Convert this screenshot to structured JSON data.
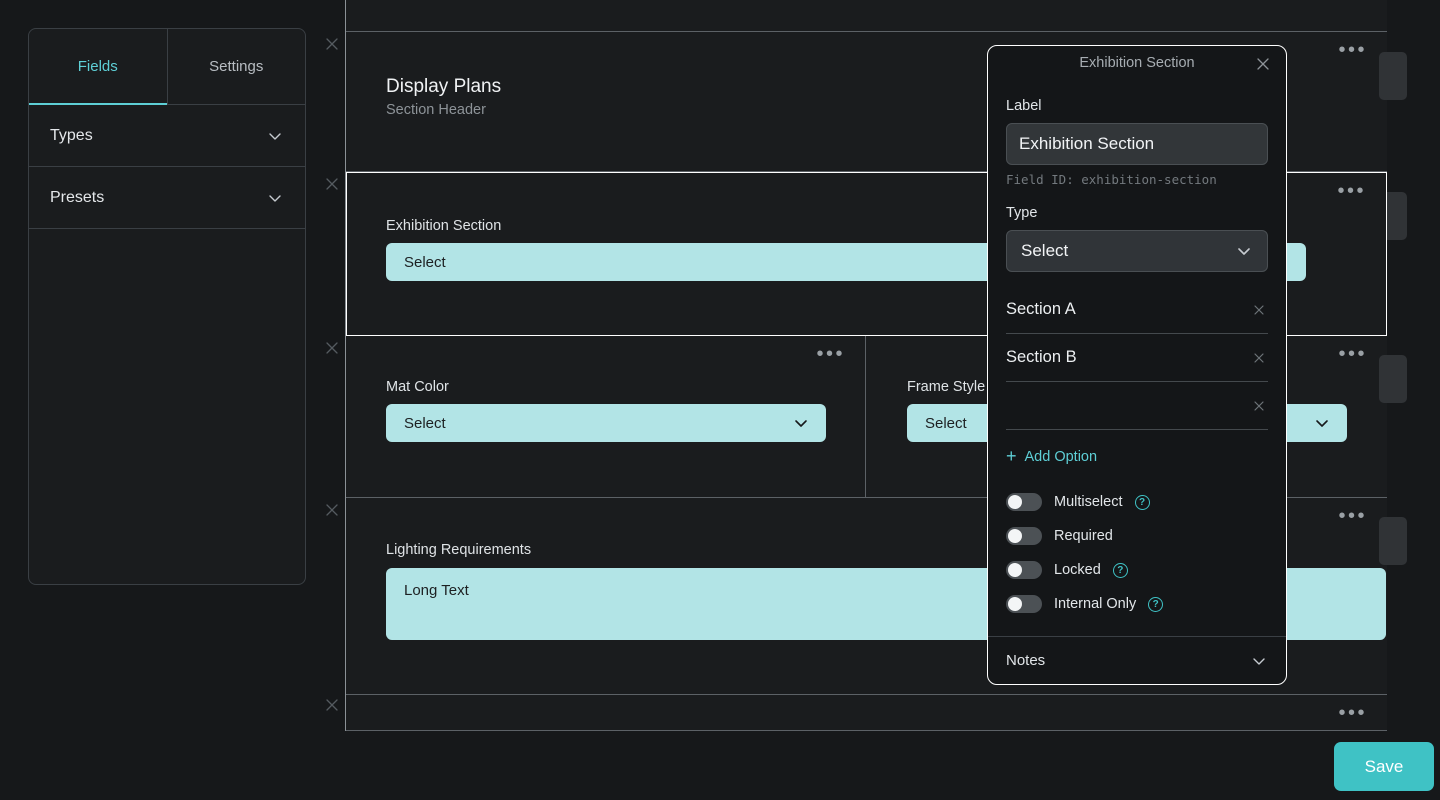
{
  "sidebar": {
    "tabs": [
      {
        "label": "Fields",
        "active": true
      },
      {
        "label": "Settings",
        "active": false
      }
    ],
    "accordions": [
      {
        "label": "Types"
      },
      {
        "label": "Presets"
      }
    ]
  },
  "canvas": {
    "rows": [
      {
        "type": "section-header",
        "title": "Display Plans",
        "subtitle": "Section Header",
        "selected": false
      },
      {
        "type": "field",
        "label": "Exhibition Section",
        "control": "Select",
        "selected": true
      },
      {
        "type": "field-pair",
        "left_label": "Mat Color",
        "left_control": "Select",
        "right_label": "Frame Style",
        "right_control": "Select",
        "selected": false
      },
      {
        "type": "field",
        "label": "Lighting Requirements",
        "control": "Long Text",
        "selected": false
      }
    ]
  },
  "modal": {
    "title": "Exhibition Section",
    "close_label": "×",
    "label_heading": "Label",
    "label_value": "Exhibition Section",
    "field_id_hint": "Field ID: exhibition-section",
    "type_heading": "Type",
    "type_value": "Select",
    "options": [
      {
        "value": "Section A"
      },
      {
        "value": "Section B"
      },
      {
        "value": ""
      }
    ],
    "add_option_label": "Add Option",
    "add_option_glyph": "+",
    "toggles": [
      {
        "label": "Multiselect",
        "on": false,
        "help": true
      },
      {
        "label": "Required",
        "on": false,
        "help": false
      },
      {
        "label": "Locked",
        "on": false,
        "help": true
      },
      {
        "label": "Internal Only",
        "on": false,
        "help": true
      }
    ],
    "help_glyph": "?",
    "notes_label": "Notes"
  },
  "footer": {
    "save_label": "Save"
  },
  "colors": {
    "accent_teal": "#3fc2c5",
    "control_fill": "#b2e4e6",
    "background": "#16181a",
    "panel": "#1a1c1e",
    "selected_border": "#ffffff"
  }
}
